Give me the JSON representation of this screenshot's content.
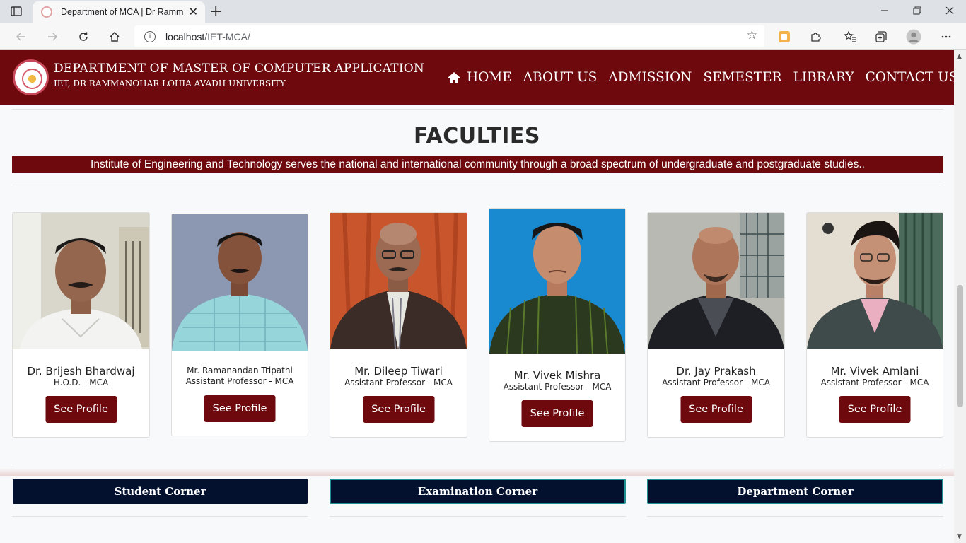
{
  "browser": {
    "tab_title": "Department of MCA | Dr Ramma",
    "url_host": "localhost",
    "url_path": "/IET-MCA/"
  },
  "site": {
    "title": "DEPARTMENT OF MASTER OF COMPUTER APPLICATION",
    "subtitle": "IET, DR RAMMANOHAR LOHIA AVADH UNIVERSITY",
    "nav": [
      "HOME",
      "ABOUT US",
      "ADMISSION",
      "SEMESTER",
      "LIBRARY",
      "CONTACT US"
    ],
    "brand_color": "#6e0a0e"
  },
  "faculties": {
    "heading": "FACULTIES",
    "banner": "Institute of Engineering and Technology serves the national and international community through a broad spectrum of undergraduate and postgraduate studies..",
    "members": [
      {
        "name": "Dr. Brijesh Bhardwaj",
        "role": "H.O.D. - MCA",
        "button": "See Profile"
      },
      {
        "name": "Mr. Ramanandan Tripathi",
        "role": "Assistant Professor - MCA",
        "button": "See Profile"
      },
      {
        "name": "Mr. Dileep Tiwari",
        "role": "Assistant Professor - MCA",
        "button": "See Profile"
      },
      {
        "name": "Mr. Vivek Mishra",
        "role": "Assistant Professor - MCA",
        "button": "See Profile"
      },
      {
        "name": "Dr. Jay Prakash",
        "role": "Assistant Professor - MCA",
        "button": "See Profile"
      },
      {
        "name": "Mr. Vivek Amlani",
        "role": "Assistant Professor - MCA",
        "button": "See Profile"
      }
    ]
  },
  "corners": [
    "Student Corner",
    "Examination Corner",
    "Department Corner"
  ]
}
